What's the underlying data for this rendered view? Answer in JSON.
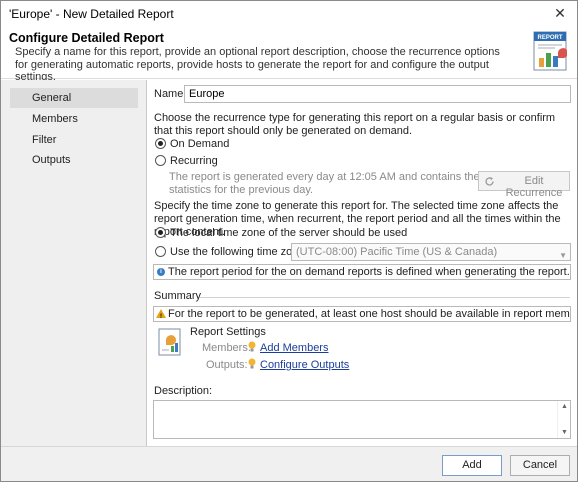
{
  "window": {
    "title": "'Europe' - New Detailed Report",
    "close_glyph": "✕"
  },
  "header": {
    "title": "Configure Detailed Report",
    "description": "Specify a name for this report, provide an optional report description, choose the recurrence options for generating automatic reports, provide hosts to generate the report for and configure the output settings.",
    "icon": "report-icon"
  },
  "nav": {
    "items": [
      {
        "label": "General",
        "active": true
      },
      {
        "label": "Members",
        "active": false
      },
      {
        "label": "Filter",
        "active": false
      },
      {
        "label": "Outputs",
        "active": false
      }
    ]
  },
  "general": {
    "name_label": "Name:",
    "name_value": "Europe",
    "recurrence_text": "Choose the recurrence type for generating this report on a regular basis or confirm that this report should only be generated on demand.",
    "on_demand_label": "On Demand",
    "recurring_label": "Recurring",
    "recurring_note": "The report is generated every day at 12:05 AM and contains the statistics for the previous day.",
    "edit_recurrence_label": "Edit Recurrence",
    "timezone_text": "Specify the time zone to generate this report for. The selected time zone affects the report generation time, when recurrent, the report period and all the times within the report content.",
    "local_tz_label": "The local time zone of the server should be used",
    "use_tz_label": "Use the following time zone:",
    "tz_value": "(UTC-08:00) Pacific Time (US & Canada)",
    "tz_info": "The report period for the on demand reports is defined when generating the report.",
    "summary_label": "Summary",
    "summary_warning": "For the report to be generated, at least one host should be available in report members and at ...",
    "report_settings_label": "Report Settings",
    "members_label": "Members:",
    "add_members_link": "Add Members",
    "outputs_label": "Outputs:",
    "configure_outputs_link": "Configure Outputs",
    "description_label": "Description:"
  },
  "footer": {
    "add_label": "Add",
    "cancel_label": "Cancel"
  }
}
